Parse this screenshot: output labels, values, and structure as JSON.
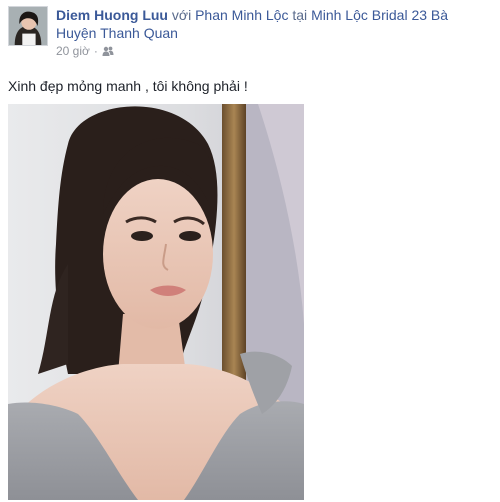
{
  "post": {
    "author": "Diem Huong Luu",
    "with_text": " với ",
    "tagged_friend": "Phan Minh Lộc",
    "at_text": " tại ",
    "place": "Minh Lộc Bridal 23 Bà Huyện Thanh Quan",
    "time": "20 giờ",
    "separator": "·",
    "audience_icon": "friends-icon",
    "caption": "Xinh đẹp mỏng manh , tôi không phải !"
  },
  "colors": {
    "link": "#3b5998",
    "meta": "#90949c",
    "text": "#1d2129"
  }
}
